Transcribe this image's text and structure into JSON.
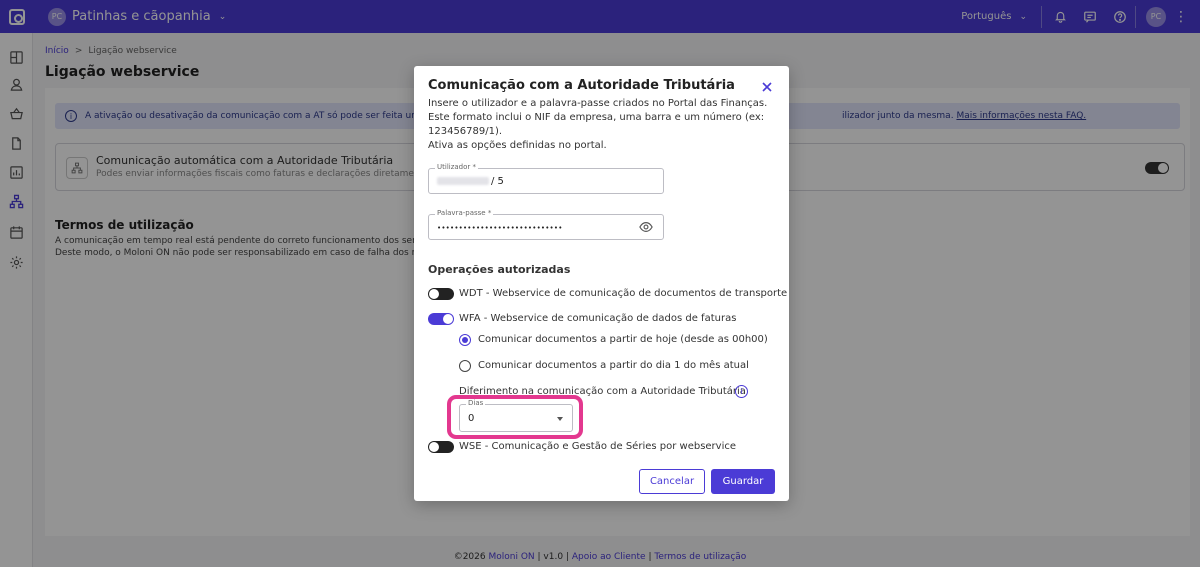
{
  "topbar": {
    "company_initials": "PC",
    "company_name": "Patinhas e cãopanhia",
    "language": "Português",
    "user_initials": "PC"
  },
  "breadcrumb": {
    "home": "Início",
    "separator": ">",
    "current": "Ligação webservice"
  },
  "page_title": "Ligação webservice",
  "info_bar": {
    "text": "A ativação ou desativação da comunicação com a AT só pode ser feita uma vez p",
    "text_right": "ilizador junto da mesma.",
    "link": "Mais informações nesta FAQ."
  },
  "auto_card": {
    "title": "Comunicação automática com a Autoridade Tributária",
    "subtitle": "Podes enviar informações fiscais como faturas e declarações diretamente par"
  },
  "terms": {
    "title": "Termos de utilização",
    "line1": "A comunicação em tempo real está pendente do correto funcionamento dos servidores",
    "line2": "Deste modo, o Moloni ON não pode ser responsabilizado em caso de falha dos mesmos"
  },
  "footer": {
    "copyright": "©2026",
    "brand": "Moloni ON",
    "version": "| v1.0 |",
    "support": "Apoio ao Cliente",
    "sep": "|",
    "terms": "Termos de utilização"
  },
  "modal": {
    "title": "Comunicação com a Autoridade Tributária",
    "description_1": "Insere o utilizador e a palavra-passe criados no Portal das Finanças.",
    "description_2": "Este formato inclui o NIF da empresa, uma barra e um número (ex: 123456789/1).",
    "description_3": "Ativa as opções definidas no portal.",
    "username_label": "Utilizador *",
    "username_suffix": "/ 5",
    "password_label": "Palavra-passe *",
    "password_value": "•••••••••••••••••••••••••••••",
    "ops_title": "Operações autorizadas",
    "ops": {
      "wdt": {
        "label": "WDT - Webservice de comunicação de documentos de transporte",
        "enabled": false
      },
      "wfa": {
        "label": "WFA - Webservice de comunicação de dados de faturas",
        "enabled": true
      },
      "wse": {
        "label": "WSE - Comunicação e Gestão de Séries por webservice",
        "enabled": false
      }
    },
    "radio_today": "Comunicar documentos a partir de hoje (desde as 00h00)",
    "radio_month": "Comunicar documentos a partir do dia 1 do mês atual",
    "deferral_label": "Diferimento na comunicação com a Autoridade Tributária",
    "days_label": "Dias",
    "days_value": "0",
    "cancel_label": "Cancelar",
    "save_label": "Guardar"
  },
  "colors": {
    "brand": "#4b3bd6",
    "highlight": "#e3388f",
    "info_bg": "#e2e5fb"
  }
}
